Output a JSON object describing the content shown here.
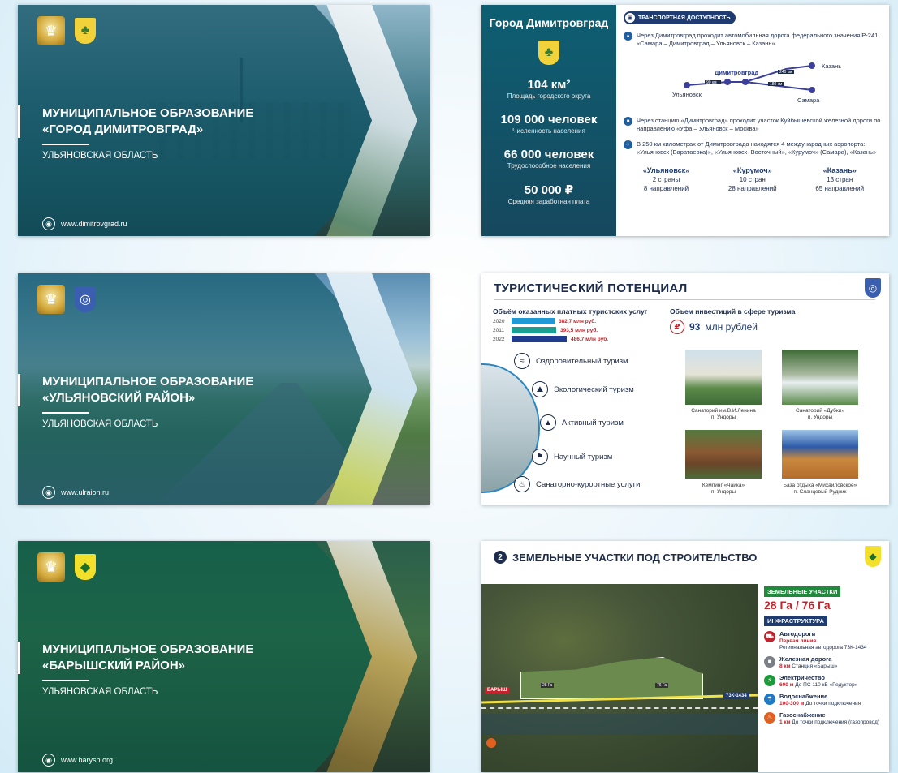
{
  "slide1": {
    "title_line1": "МУНИЦИПАЛЬНОЕ ОБРАЗОВАНИЕ",
    "title_line2": "«ГОРОД ДИМИТРОВГРАД»",
    "subtitle": "УЛЬЯНОВСКАЯ ОБЛАСТЬ",
    "website": "www.dimitrovgrad.ru"
  },
  "slide2": {
    "city": "Город Димитровград",
    "stats": [
      {
        "value": "104 км²",
        "label": "Площадь городского округа"
      },
      {
        "value": "109 000 человек",
        "label": "Численность населения"
      },
      {
        "value": "66 000 человек",
        "label": "Трудоспособное населения"
      },
      {
        "value": "50 000 ₽",
        "label": "Средняя заработная плата"
      }
    ],
    "section": "ТРАНСПОРТНАЯ ДОСТУПНОСТЬ",
    "road_text": "Через Димитровград проходит автомобильная дорога федерального значения Р-241 «Самара – Димитровград – Ульяновск – Казань».",
    "map": {
      "dimitrovgrad": "Димитровград",
      "ulyanovsk": "Ульяновск",
      "kazan": "Казань",
      "samara": "Самара",
      "d1": "90 км",
      "d2": "180 км",
      "d3": "240 км"
    },
    "rail_text": "Через станцию «Димитровград» проходит участок Куйбышевской железной дороги по направлению «Уфа – Ульяновск – Москва»",
    "air_text": "В 250 км километрах от Димитровграда находятся 4 международных аэропорта: «Ульяновск (Баратаевка)», «Ульяновск- Восточный», «Курумоч» (Самара), «Казань»",
    "airports": [
      {
        "name": "«Ульяновск»",
        "countries": "2 страны",
        "routes": "8 направлений"
      },
      {
        "name": "«Курумоч»",
        "countries": "10 стран",
        "routes": "28 направлений"
      },
      {
        "name": "«Казань»",
        "countries": "13 стран",
        "routes": "65 направлений"
      }
    ]
  },
  "slide3": {
    "title_line1": "МУНИЦИПАЛЬНОЕ ОБРАЗОВАНИЕ",
    "title_line2": "«УЛЬЯНОВСКИЙ РАЙОН»",
    "subtitle": "УЛЬЯНОВСКАЯ ОБЛАСТЬ",
    "website": "www.ulraion.ru"
  },
  "slide4": {
    "title": "ТУРИСТИЧЕСКИЙ ПОТЕНЦИАЛ",
    "services_title": "Объём оказанных платных туристских услуг",
    "bars": [
      {
        "year": "2020",
        "label": "382,7 млн руб.",
        "value": 382.7,
        "color": "#1f9ad6"
      },
      {
        "year": "2011",
        "label": "393,5 млн руб.",
        "value": 393.5,
        "color": "#1aa093"
      },
      {
        "year": "2022",
        "label": "486,7 млн руб.",
        "value": 486.7,
        "color": "#1f3b8f"
      }
    ],
    "invest_title": "Объем инвестиций в сфере туризма",
    "invest_value": "93",
    "invest_unit": "млн рублей",
    "tourism": [
      {
        "label": "Оздоровительный туризм",
        "icon": "swim-icon"
      },
      {
        "label": "Экологический туризм",
        "icon": "hike-icon"
      },
      {
        "label": "Активный туризм",
        "icon": "mountain-icon"
      },
      {
        "label": "Научный туризм",
        "icon": "explore-icon"
      },
      {
        "label": "Санаторно-курортные услуги",
        "icon": "spa-icon"
      }
    ],
    "places": [
      {
        "name": "Санаторий им.В.И.Ленина",
        "loc": "п. Ундоры"
      },
      {
        "name": "Санаторий «Дубки»",
        "loc": "п. Ундоры"
      },
      {
        "name": "Кемпинг «Чайка»",
        "loc": "п. Ундоры"
      },
      {
        "name": "База отдыха «Михайловское»",
        "loc": "п. Сланцевый Рудник"
      }
    ]
  },
  "slide5": {
    "title_line1": "МУНИЦИПАЛЬНОЕ ОБРАЗОВАНИЕ",
    "title_line2": "«БАРЫШСКИЙ РАЙОН»",
    "subtitle": "УЛЬЯНОВСКАЯ ОБЛАСТЬ",
    "website": "www.barysh.org"
  },
  "slide6": {
    "number": "2",
    "title": "ЗЕМЕЛЬНЫЕ УЧАСТКИ ПОД СТРОИТЕЛЬСТВО",
    "land_header": "ЗЕМЕЛЬНЫЕ УЧАСТКИ",
    "land_area": "28 Га / 76 Га",
    "infra_header": "ИНФРАСТРУКТУРА",
    "map_labels": {
      "town": "БАРЫШ",
      "p1": "28 Га",
      "p2": "76 Га",
      "road": "73К-1434"
    },
    "infra": [
      {
        "name": "Автодороги",
        "red": "Первая линия",
        "note": "Региональная автодорога 73К-1434",
        "color": "#c0242c",
        "icon": "road-icon"
      },
      {
        "name": "Железная дорога",
        "red": "8 км",
        "note": "Станция «Барыш»",
        "color": "#7a7f88",
        "icon": "train-icon"
      },
      {
        "name": "Электричество",
        "red": "600 м",
        "note": "До ПС 110 кВ «Редуктор»",
        "color": "#1f9a3b",
        "icon": "power-icon"
      },
      {
        "name": "Водоснабжение",
        "red": "100-300 м",
        "note": "До точки подключения",
        "color": "#1f7ac6",
        "icon": "water-icon"
      },
      {
        "name": "Газоснабжение",
        "red": "1 км",
        "note": "До точки подключения (газопровод)",
        "color": "#e0611f",
        "icon": "gas-icon"
      }
    ]
  }
}
